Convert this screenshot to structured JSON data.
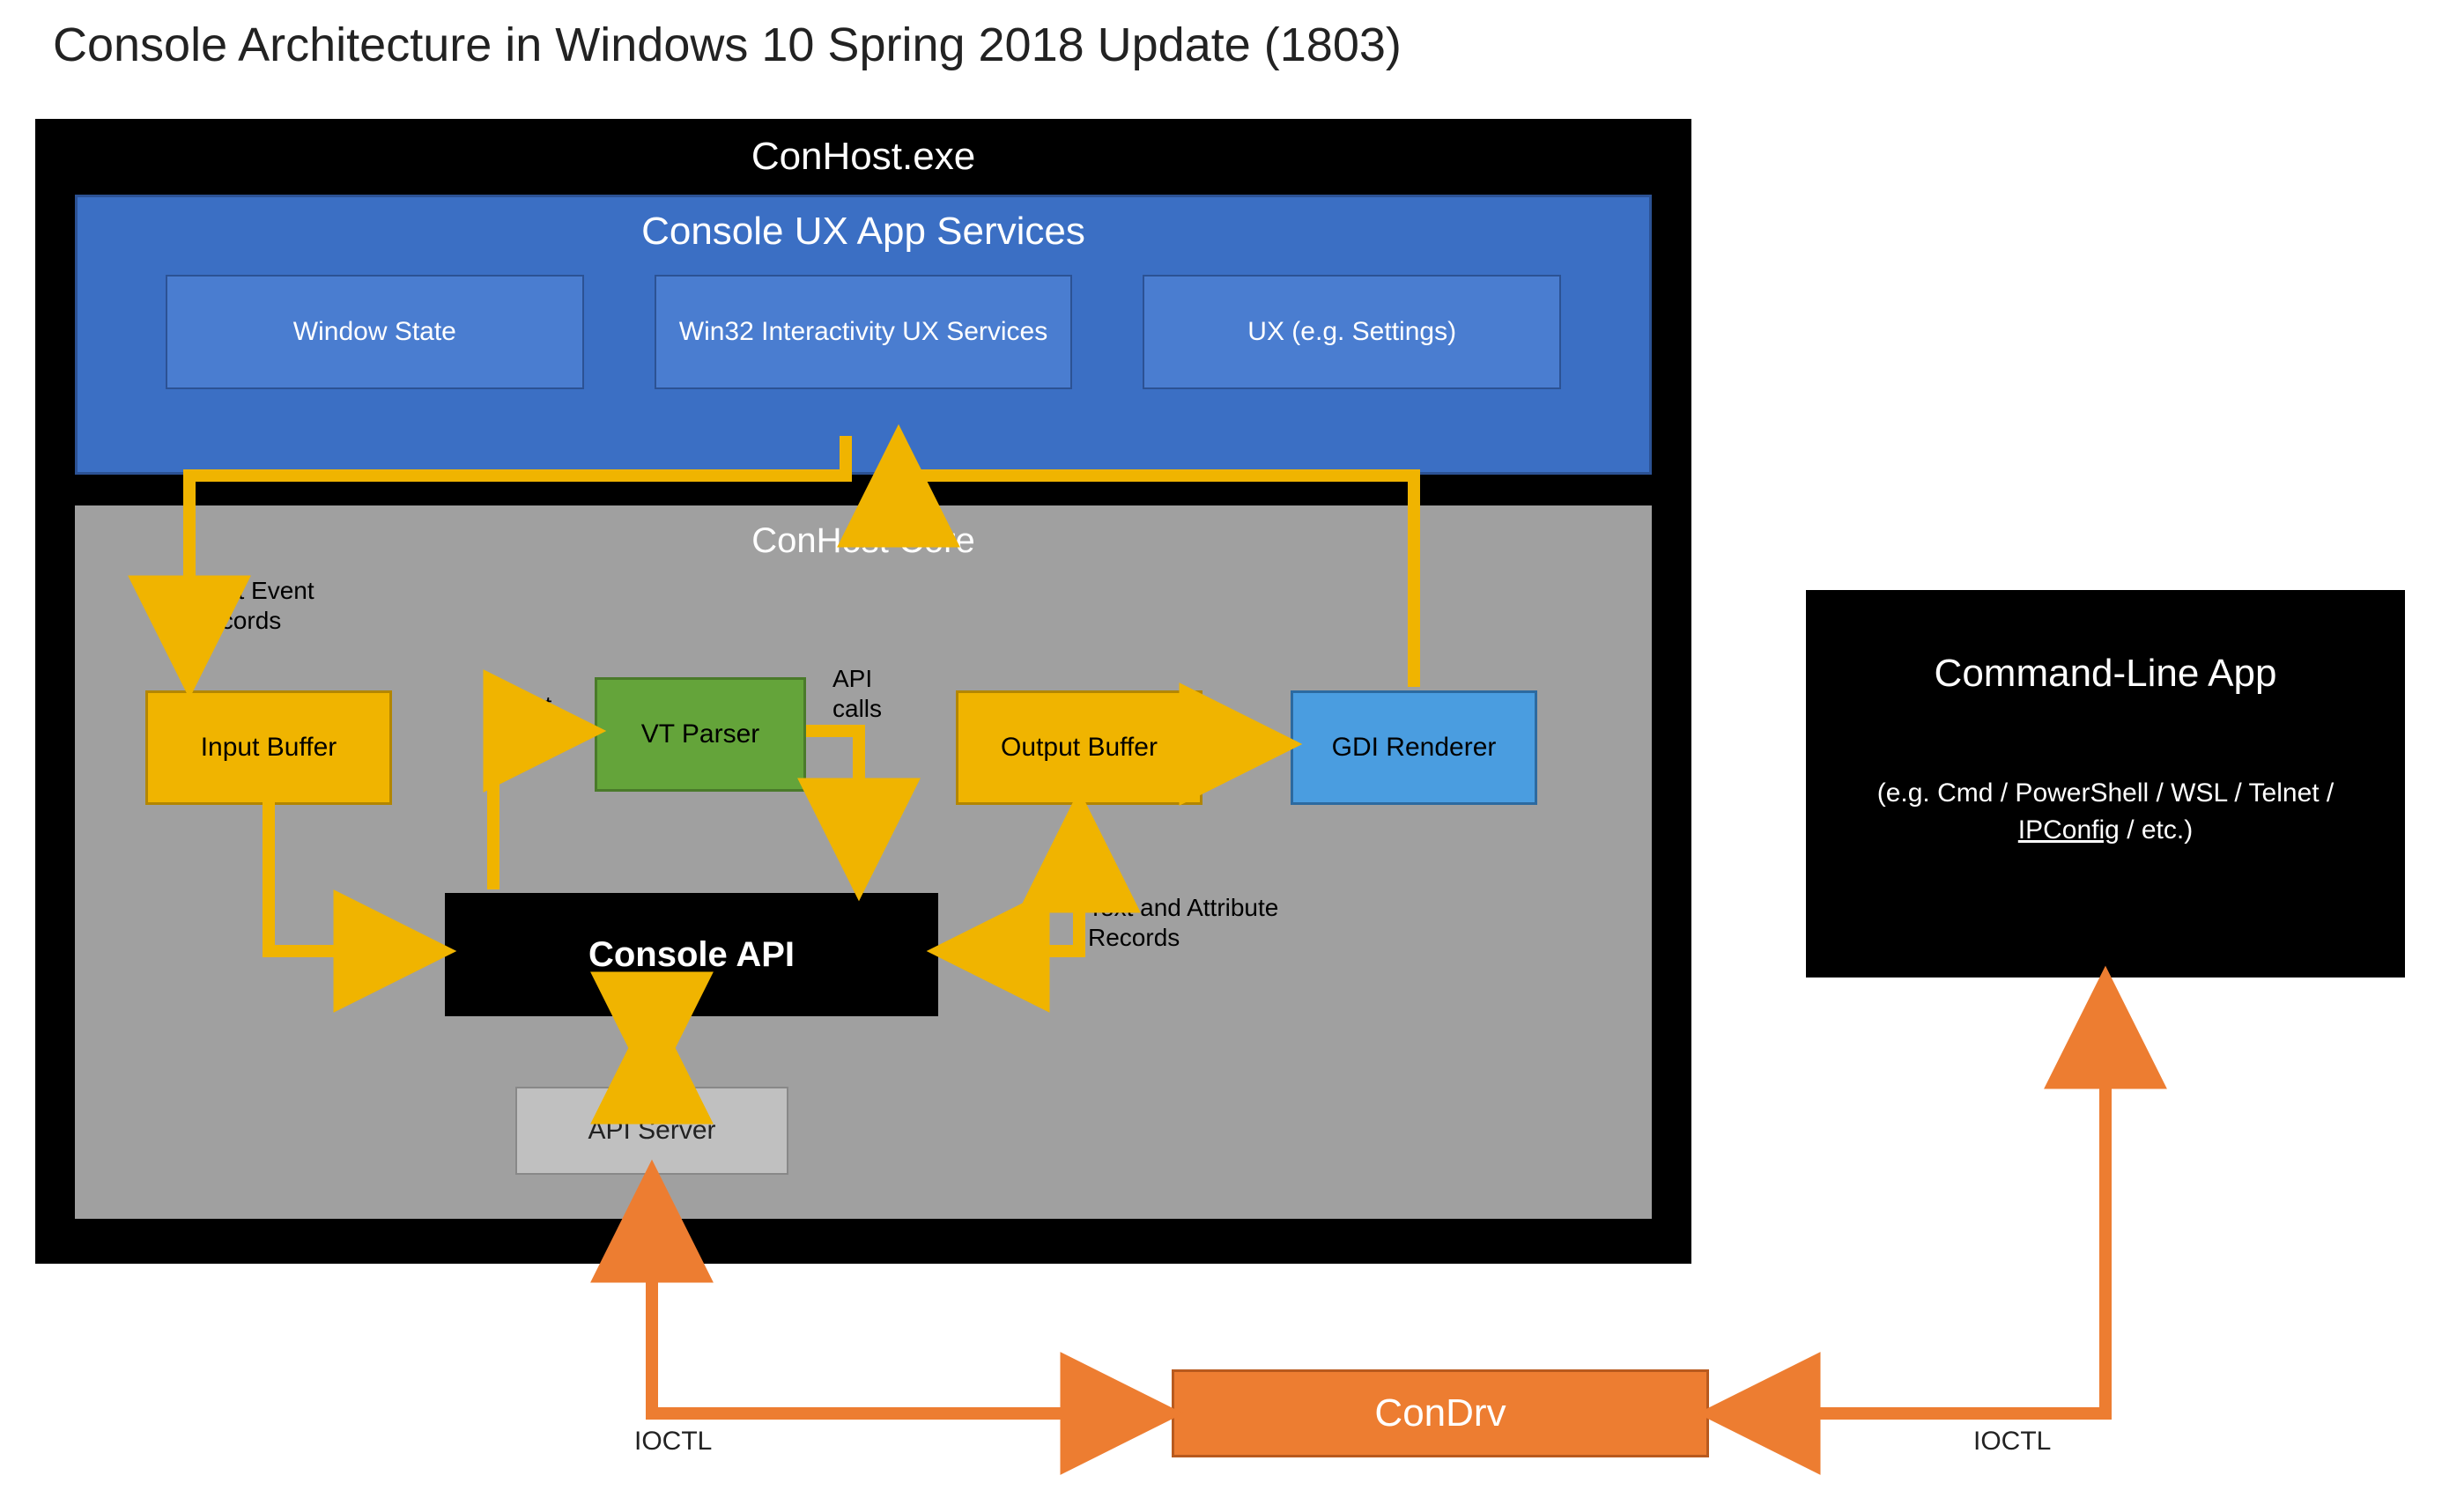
{
  "title": "Console Architecture in Windows 10 Spring 2018 Update (1803)",
  "conhost": {
    "label": "ConHost.exe",
    "ux": {
      "label": "Console UX App Services",
      "boxes": {
        "window_state": "Window State",
        "win32": "Win32 Interactivity UX Services",
        "settings": "UX (e.g. Settings)"
      }
    },
    "core": {
      "label": "ConHost Core",
      "input_buffer": "Input Buffer",
      "vt_parser": "VT Parser",
      "output_buffer": "Output Buffer",
      "gdi_renderer": "GDI Renderer",
      "console_api": "Console API",
      "api_server": "API Server",
      "labels": {
        "input_event": "Input Event Records",
        "text": "Text",
        "api_calls": "API calls",
        "text_attr": "Text and Attribute Records"
      }
    }
  },
  "cli": {
    "main": "Command-Line App",
    "sub_prefix": "(e.g. Cmd / PowerShell / WSL / Telnet / ",
    "sub_ul": "IPConfig",
    "sub_suffix": " / etc.)"
  },
  "condrv": "ConDrv",
  "ioctl": "IOCTL",
  "colors": {
    "arrow": "#f0b400",
    "arrow_orange": "#ed7d31"
  }
}
